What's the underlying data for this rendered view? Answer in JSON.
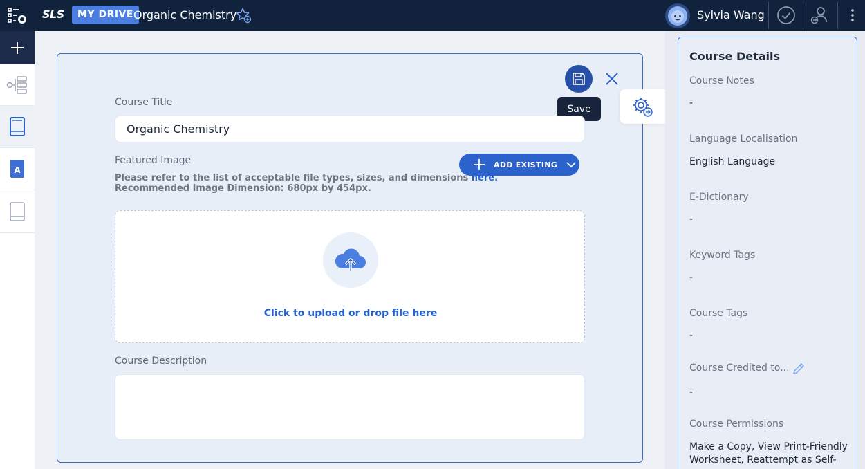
{
  "topbar": {
    "logo": "SLS",
    "badge": "MY DRIVE",
    "title": "Organic Chemistry",
    "user_name": "Sylvia Wang"
  },
  "form": {
    "course_title_label": "Course Title",
    "course_title_value": "Organic Chemistry",
    "featured_image_label": "Featured Image",
    "hint_line1": "Please refer to the list of acceptable file types, sizes, and dimensions ",
    "hint_link": "here.",
    "hint_line2": "Recommended Image Dimension: 680px by 454px.",
    "add_existing_label": "ADD EXISTING",
    "upload_text": "Click to upload or drop file here",
    "course_description_label": "Course Description",
    "course_description_value": "",
    "save_tooltip": "Save"
  },
  "details": {
    "title": "Course Details",
    "fields": [
      {
        "label": "Course Notes",
        "value": "-"
      },
      {
        "label": "Language Localisation",
        "value": "English Language"
      },
      {
        "label": "E-Dictionary",
        "value": "-"
      },
      {
        "label": "Keyword Tags",
        "value": "-"
      },
      {
        "label": "Course Tags",
        "value": "-"
      },
      {
        "label": "Course Credited to...",
        "value": "-"
      },
      {
        "label": "Course Permissions",
        "value": "Make a Copy, View Print-Friendly Worksheet, Reattempt as Self-"
      }
    ]
  },
  "colors": {
    "topbar": "#11223d",
    "accent": "#2c62cc",
    "card_border": "#3b6bc9",
    "link": "#2762d3"
  }
}
